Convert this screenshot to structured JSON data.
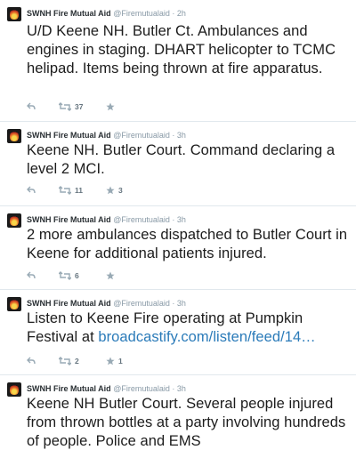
{
  "account": {
    "name": "SWNH Fire Mutual Aid",
    "handle": "@Firemutualaid",
    "separator": "·"
  },
  "tweets": [
    {
      "time": "2h",
      "text": "U/D Keene NH. Butler Ct. Ambulances and engines in staging. DHART helicopter to TCMC helipad. Items being thrown at fire apparatus.",
      "retweets": "37",
      "favorites": ""
    },
    {
      "time": "3h",
      "text": "Keene NH. Butler Court. Command declaring a level 2 MCI.",
      "retweets": "11",
      "favorites": "3"
    },
    {
      "time": "3h",
      "text": "2 more ambulances dispatched to Butler Court in Keene for additional patients injured.",
      "retweets": "6",
      "favorites": ""
    },
    {
      "time": "3h",
      "text_before_link": "Listen to Keene Fire operating at Pumpkin Festival at ",
      "link": "broadcastify.com/listen/feed/14…",
      "retweets": "2",
      "favorites": "1"
    },
    {
      "time": "3h",
      "text": "Keene NH  Butler Court. Several people injured from thrown bottles at a party involving hundreds of people. Police and  EMS"
    }
  ],
  "icons": {
    "reply": "reply-icon",
    "retweet": "retweet-icon",
    "favorite": "star-icon",
    "avatar": "flame-logo"
  },
  "colors": {
    "link": "#2b7bb9",
    "meta": "#8899a6",
    "divider": "#e1e8ed"
  }
}
